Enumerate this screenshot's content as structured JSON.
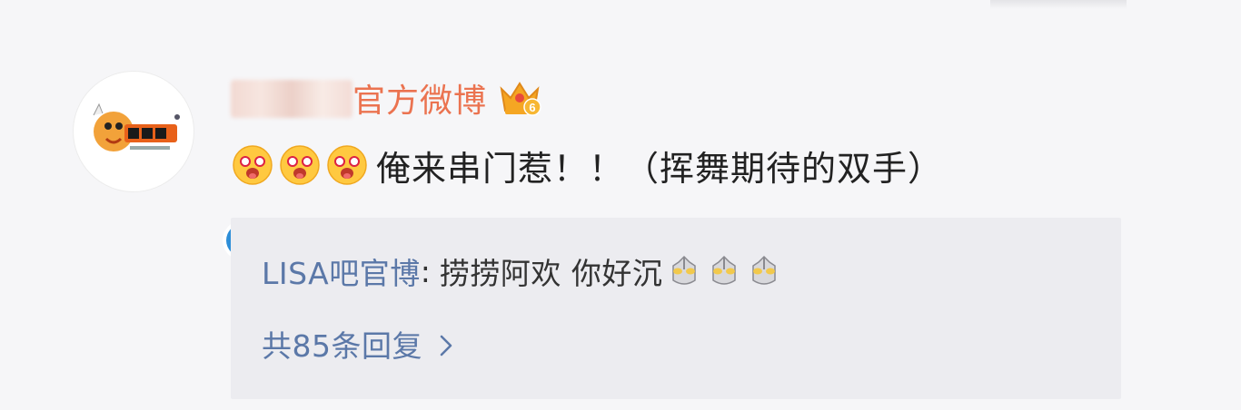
{
  "post": {
    "username_suffix": "官方微博",
    "level_badge": "6",
    "comment_text": "俺来串门惹！！（挥舞期待的双手）",
    "emoji_icons": [
      "drooling-face-icon",
      "drooling-face-icon",
      "drooling-face-icon"
    ],
    "verified_icon": "verified-v-icon"
  },
  "reply": {
    "user": "LISA吧官博",
    "colon": ":",
    "text": "捞捞阿欢 你好沉",
    "emoji_icons": [
      "ultraman-icon",
      "ultraman-icon",
      "ultraman-icon"
    ],
    "more_label": "共85条回复"
  },
  "colors": {
    "username": "#eb7350",
    "link": "#5b78a8",
    "verified": "#2d8ed8",
    "crown": "#f5a623"
  }
}
